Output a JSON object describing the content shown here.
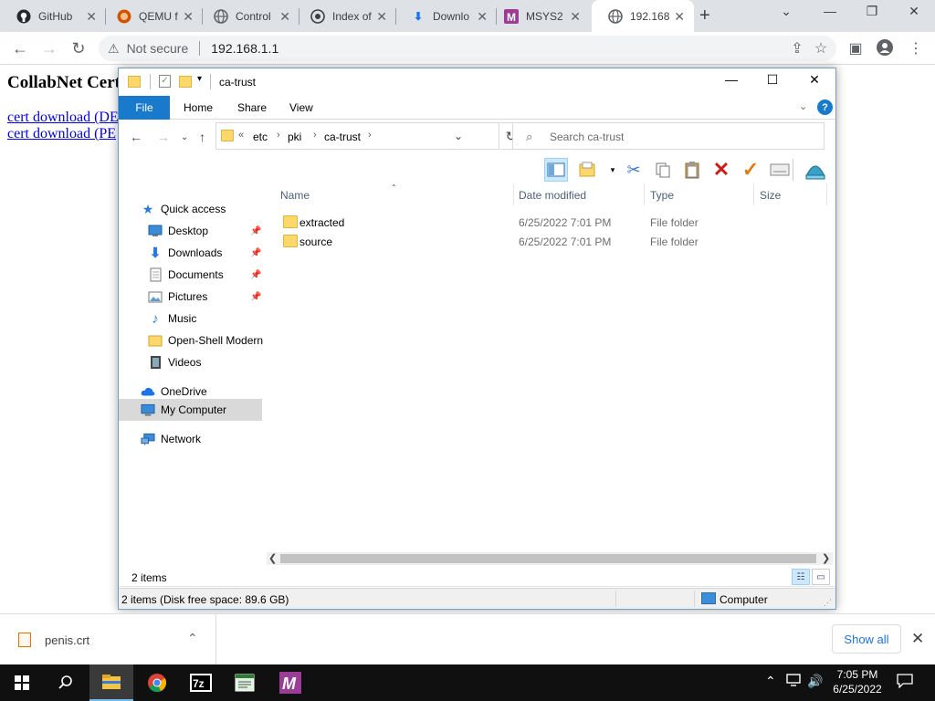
{
  "browser": {
    "tabs": [
      {
        "label": "GitHub",
        "icon": "github-icon"
      },
      {
        "label": "QEMU f",
        "icon": "qemu-icon"
      },
      {
        "label": "Control",
        "icon": "globe-icon"
      },
      {
        "label": "Index of",
        "icon": "index-icon"
      },
      {
        "label": "Downlo",
        "icon": "download-icon"
      },
      {
        "label": "MSYS2",
        "icon": "msys2-icon"
      },
      {
        "label": "192.168",
        "icon": "globe-icon"
      }
    ],
    "new_tab": "+",
    "address": {
      "security_label": "Not secure",
      "url": "192.168.1.1"
    }
  },
  "page": {
    "title": "CollabNet Cert",
    "links": [
      "cert download (DE",
      "cert download (PE"
    ]
  },
  "explorer": {
    "title": "ca-trust",
    "ribbon_tabs": [
      "File",
      "Home",
      "Share",
      "View"
    ],
    "help": "?",
    "breadcrumb": {
      "overflow": "«",
      "parts": [
        "etc",
        "pki",
        "ca-trust"
      ]
    },
    "search_placeholder": "Search ca-trust",
    "nav": {
      "quick_access": "Quick access",
      "pinned": [
        "Desktop",
        "Downloads",
        "Documents",
        "Pictures"
      ],
      "others": [
        "Music",
        "Open-Shell Modern",
        "Videos"
      ],
      "onedrive": "OneDrive",
      "my_computer": "My Computer",
      "network": "Network"
    },
    "columns": [
      "Name",
      "Date modified",
      "Type",
      "Size"
    ],
    "files": [
      {
        "name": "extracted",
        "date": "6/25/2022 7:01 PM",
        "type": "File folder"
      },
      {
        "name": "source",
        "date": "6/25/2022 7:01 PM",
        "type": "File folder"
      }
    ],
    "item_count": "2 items",
    "status": "2 items (Disk free space: 89.6 GB)",
    "status_location": "Computer"
  },
  "downloads": {
    "file": "penis.crt",
    "show_all": "Show all"
  },
  "taskbar": {
    "time": "7:05 PM",
    "date": "6/25/2022",
    "apps": [
      "file-explorer",
      "chrome",
      "7zip",
      "notepad",
      "msys2"
    ],
    "active_app": "file-explorer"
  },
  "colors": {
    "accent_blue": "#1979ca",
    "folder_yellow": "#fcd769",
    "taskbar": "#101010",
    "chrome_tabbar": "#dee1e6"
  }
}
